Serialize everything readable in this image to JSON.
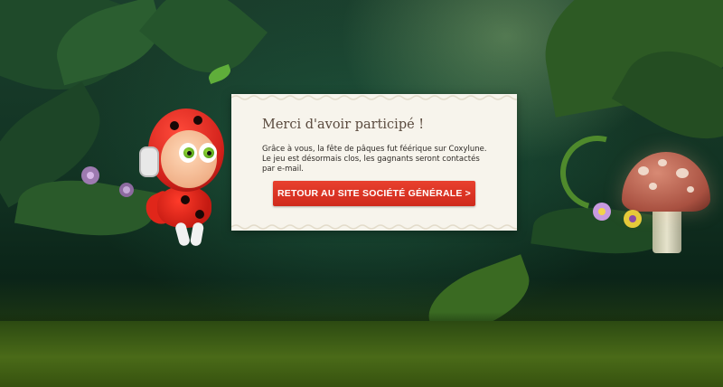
{
  "panel": {
    "title": "Merci d'avoir participé !",
    "line1": "Grâce à vous, la fête de pâques fut féérique sur Coxylune.",
    "line2": "Le jeu est désormais clos, les gagnants seront contactés par e-mail.",
    "button_label": "RETOUR AU SITE SOCIÉTÉ GÉNÉRALE >"
  },
  "colors": {
    "accent": "#d9301f",
    "panel_bg": "#f7f4ec",
    "panel_title": "#5a4a3e"
  },
  "icons": {
    "mascot": "ladybug-mascot-icon",
    "mushroom": "mushroom-icon",
    "flower": "flower-icon"
  }
}
